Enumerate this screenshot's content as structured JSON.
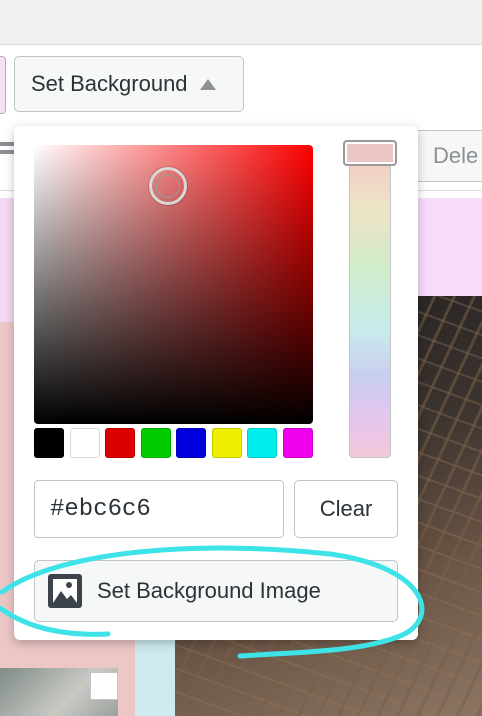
{
  "toolbar": {
    "set_background_label": "Set Background",
    "delete_label": "Dele"
  },
  "picker": {
    "hex_value": "#ebc6c6",
    "clear_label": "Clear",
    "set_background_image_label": "Set Background Image",
    "swatches": [
      "#000000",
      "#ffffff",
      "#dd0000",
      "#00cc00",
      "#0000dd",
      "#eeee00",
      "#00eeee",
      "#ee00ee"
    ]
  },
  "colors": {
    "annotation": "#3ee3e8",
    "selected": "#ebc6c6"
  }
}
